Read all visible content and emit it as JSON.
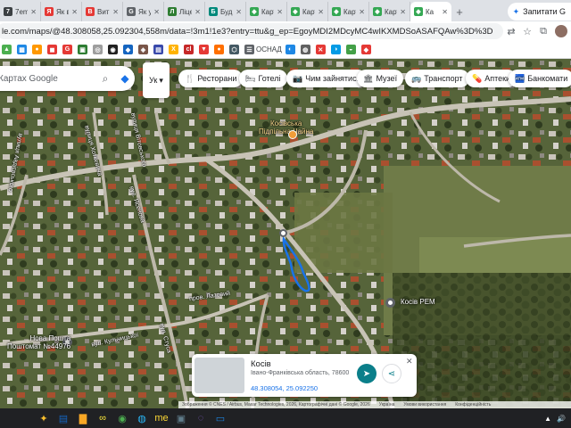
{
  "browser": {
    "tabs": [
      {
        "label": "7emin",
        "favicon": "7",
        "color": "#3c4043"
      },
      {
        "label": "Як від",
        "favicon": "Я",
        "color": "#e53935"
      },
      {
        "label": "Витрат",
        "favicon": "В",
        "color": "#e53935"
      },
      {
        "label": "Як у п",
        "favicon": "G",
        "color": "#5f6368"
      },
      {
        "label": "Ліценз",
        "favicon": "Л",
        "color": "#2e7d32"
      },
      {
        "label": "Будин",
        "favicon": "Б",
        "color": "#00897b"
      },
      {
        "label": "Карти",
        "favicon": "◆",
        "color": "#34a853"
      },
      {
        "label": "Карти",
        "favicon": "◆",
        "color": "#34a853"
      },
      {
        "label": "Карти",
        "favicon": "◆",
        "color": "#34a853"
      },
      {
        "label": "Карти",
        "favicon": "◆",
        "color": "#34a853"
      },
      {
        "label": "Ка",
        "favicon": "◆",
        "color": "#34a853",
        "active": true
      }
    ],
    "new_tab": "+",
    "ask_gemini": "Запитати G",
    "url": "le.com/maps/@48.308058,25.092304,558m/data=!3m1!1e3?entry=ttu&g_ep=EgoyMDI2MDcyMC4wIKXMDSoASAFQAw%3D%3D",
    "bookmarks": [
      {
        "label": "",
        "color": "#4caf50",
        "glyph": "▲"
      },
      {
        "label": "",
        "color": "#1e88e5",
        "glyph": "▦"
      },
      {
        "label": "",
        "color": "#ff9800",
        "glyph": "●"
      },
      {
        "label": "",
        "color": "#e53935",
        "glyph": "◼"
      },
      {
        "label": "",
        "color": "#e53935",
        "glyph": "G"
      },
      {
        "label": "",
        "color": "#2e7d32",
        "glyph": "▣"
      },
      {
        "label": "",
        "color": "#9e9e9e",
        "glyph": "◎"
      },
      {
        "label": "",
        "color": "#212121",
        "glyph": "◉"
      },
      {
        "label": "",
        "color": "#1565c0",
        "glyph": "◆"
      },
      {
        "label": "",
        "color": "#795548",
        "glyph": "◈"
      },
      {
        "label": "",
        "color": "#3949ab",
        "glyph": "▤"
      },
      {
        "label": "",
        "color": "#ffb300",
        "glyph": "X"
      },
      {
        "label": "",
        "color": "#c62828",
        "glyph": "cl"
      },
      {
        "label": "",
        "color": "#e53935",
        "glyph": "▼"
      },
      {
        "label": "",
        "color": "#ff6f00",
        "glyph": "●"
      },
      {
        "label": "",
        "color": "#455a64",
        "glyph": "⬡"
      },
      {
        "label": "ОСНАД",
        "color": "#5f6368",
        "glyph": "☰"
      },
      {
        "label": "",
        "color": "#1e88e5",
        "glyph": "◐"
      },
      {
        "label": "",
        "color": "#616161",
        "glyph": "◍"
      },
      {
        "label": "",
        "color": "#e53935",
        "glyph": "✕"
      },
      {
        "label": "",
        "color": "#039be5",
        "glyph": "◑"
      },
      {
        "label": "",
        "color": "#43a047",
        "glyph": "◒"
      },
      {
        "label": "",
        "color": "#e53935",
        "glyph": "◆"
      }
    ]
  },
  "map": {
    "search_placeholder": "Пошук на Картах Google",
    "search_visible": "Картах Google",
    "language": "Ук",
    "chips": [
      {
        "label": "Ресторани",
        "icon": "🍴"
      },
      {
        "label": "Готелі",
        "icon": "🛏"
      },
      {
        "label": "Чим зайнятися",
        "icon": "📷"
      },
      {
        "label": "Музеї",
        "icon": "🏛"
      },
      {
        "label": "Транспорт",
        "icon": "🚌"
      },
      {
        "label": "Аптеки",
        "icon": "💊"
      },
      {
        "label": "Банкомати",
        "icon": "🏧"
      }
    ],
    "place_labels": {
      "kosiv_cafe": "Косівська\nПідпільна Чайна",
      "kosiv_rem": "Косів РЕМ",
      "nova_poshta": "Нова Пошта\nПоштомат №44976"
    },
    "street_labels": {
      "vitovskoho": "вулиця Вітовського",
      "khotkevycha": "вулиця Хоткевича",
      "avdiyevskoi": "вулиця Авдієвського",
      "lazovyi": "пров. Лазовий",
      "kulchytskoi": "вул. Кульчицької",
      "yasenova": "вул. Ясенова",
      "stusa": "вул. Стуса"
    },
    "info_card": {
      "title": "Косів",
      "subtitle": "Івано-Франківська область, 78600",
      "coords": "48.308054, 25.092250",
      "directions_icon": "directions-icon",
      "share_icon": "share-icon"
    },
    "attribution": [
      "Зображення © CNES / Airbus, Maxar Technologies, 2026, Картографічні дані © Google, 2026",
      "Україна",
      "Умови використання",
      "Конфіденційність"
    ]
  },
  "taskbar": {
    "apps": [
      {
        "name": "widgets",
        "glyph": "✦",
        "color": "#fbc02d"
      },
      {
        "name": "outlook",
        "glyph": "▤",
        "color": "#1565c0"
      },
      {
        "name": "explorer",
        "glyph": "▇",
        "color": "#f9a825"
      },
      {
        "name": "infinity",
        "glyph": "∞",
        "color": "#ffeb3b"
      },
      {
        "name": "chrome",
        "glyph": "◉",
        "color": "#4caf50"
      },
      {
        "name": "edge",
        "glyph": "◍",
        "color": "#29b6f6"
      },
      {
        "name": "me",
        "glyph": "me",
        "color": "#fdd835"
      },
      {
        "name": "app",
        "glyph": "▣",
        "color": "#607d8b"
      },
      {
        "name": "viber",
        "glyph": "◌",
        "color": "#7e57c2"
      },
      {
        "name": "tv",
        "glyph": "▭",
        "color": "#1e88e5"
      }
    ],
    "tray": [
      "▲",
      "🔊"
    ]
  }
}
